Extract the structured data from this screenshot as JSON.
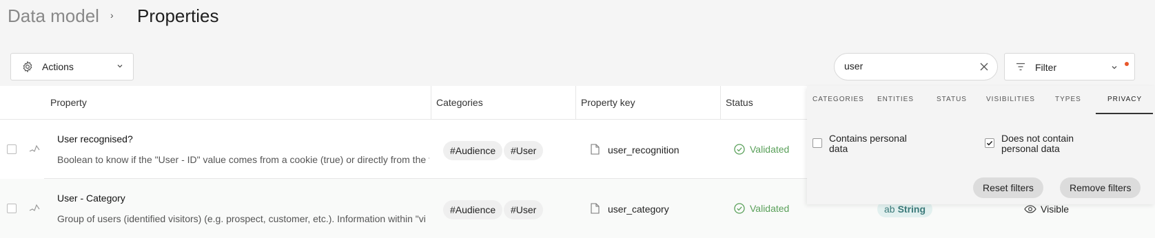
{
  "breadcrumb": {
    "parent": "Data model",
    "separator": "›",
    "current": "Properties"
  },
  "toolbar": {
    "actions_label": "Actions",
    "search_value": "user",
    "filter_label": "Filter"
  },
  "table": {
    "columns": [
      "Property",
      "Categories",
      "Property key",
      "Status"
    ],
    "rows": [
      {
        "name": "User recognised?",
        "description": "Boolean to know if the \"User - ID\" value comes from a cookie (true) or directly from the t",
        "tags": [
          "#Audience",
          "#User"
        ],
        "key": "user_recognition",
        "status": "Validated"
      },
      {
        "name": "User - Category",
        "description": "Group of users (identified visitors) (e.g. prospect, customer, etc.). Information within \"vi",
        "tags": [
          "#Audience",
          "#User"
        ],
        "key": "user_category",
        "status": "Validated",
        "type_prefix": "ab",
        "type": "String",
        "visibility": "Visible"
      }
    ]
  },
  "filter_panel": {
    "tabs": [
      "CATEGORIES",
      "ENTITIES",
      "STATUS",
      "VISIBILITIES",
      "TYPES",
      "PRIVACY"
    ],
    "active_tab": "PRIVACY",
    "options": [
      {
        "label": "Contains personal data",
        "checked": false
      },
      {
        "label": "Does not contain personal data",
        "checked": true
      }
    ],
    "reset_label": "Reset filters",
    "remove_label": "Remove filters"
  },
  "colors": {
    "validated": "#5aa05a",
    "accent_dot": "#e8572a",
    "type_badge": "#3b7a7a"
  }
}
